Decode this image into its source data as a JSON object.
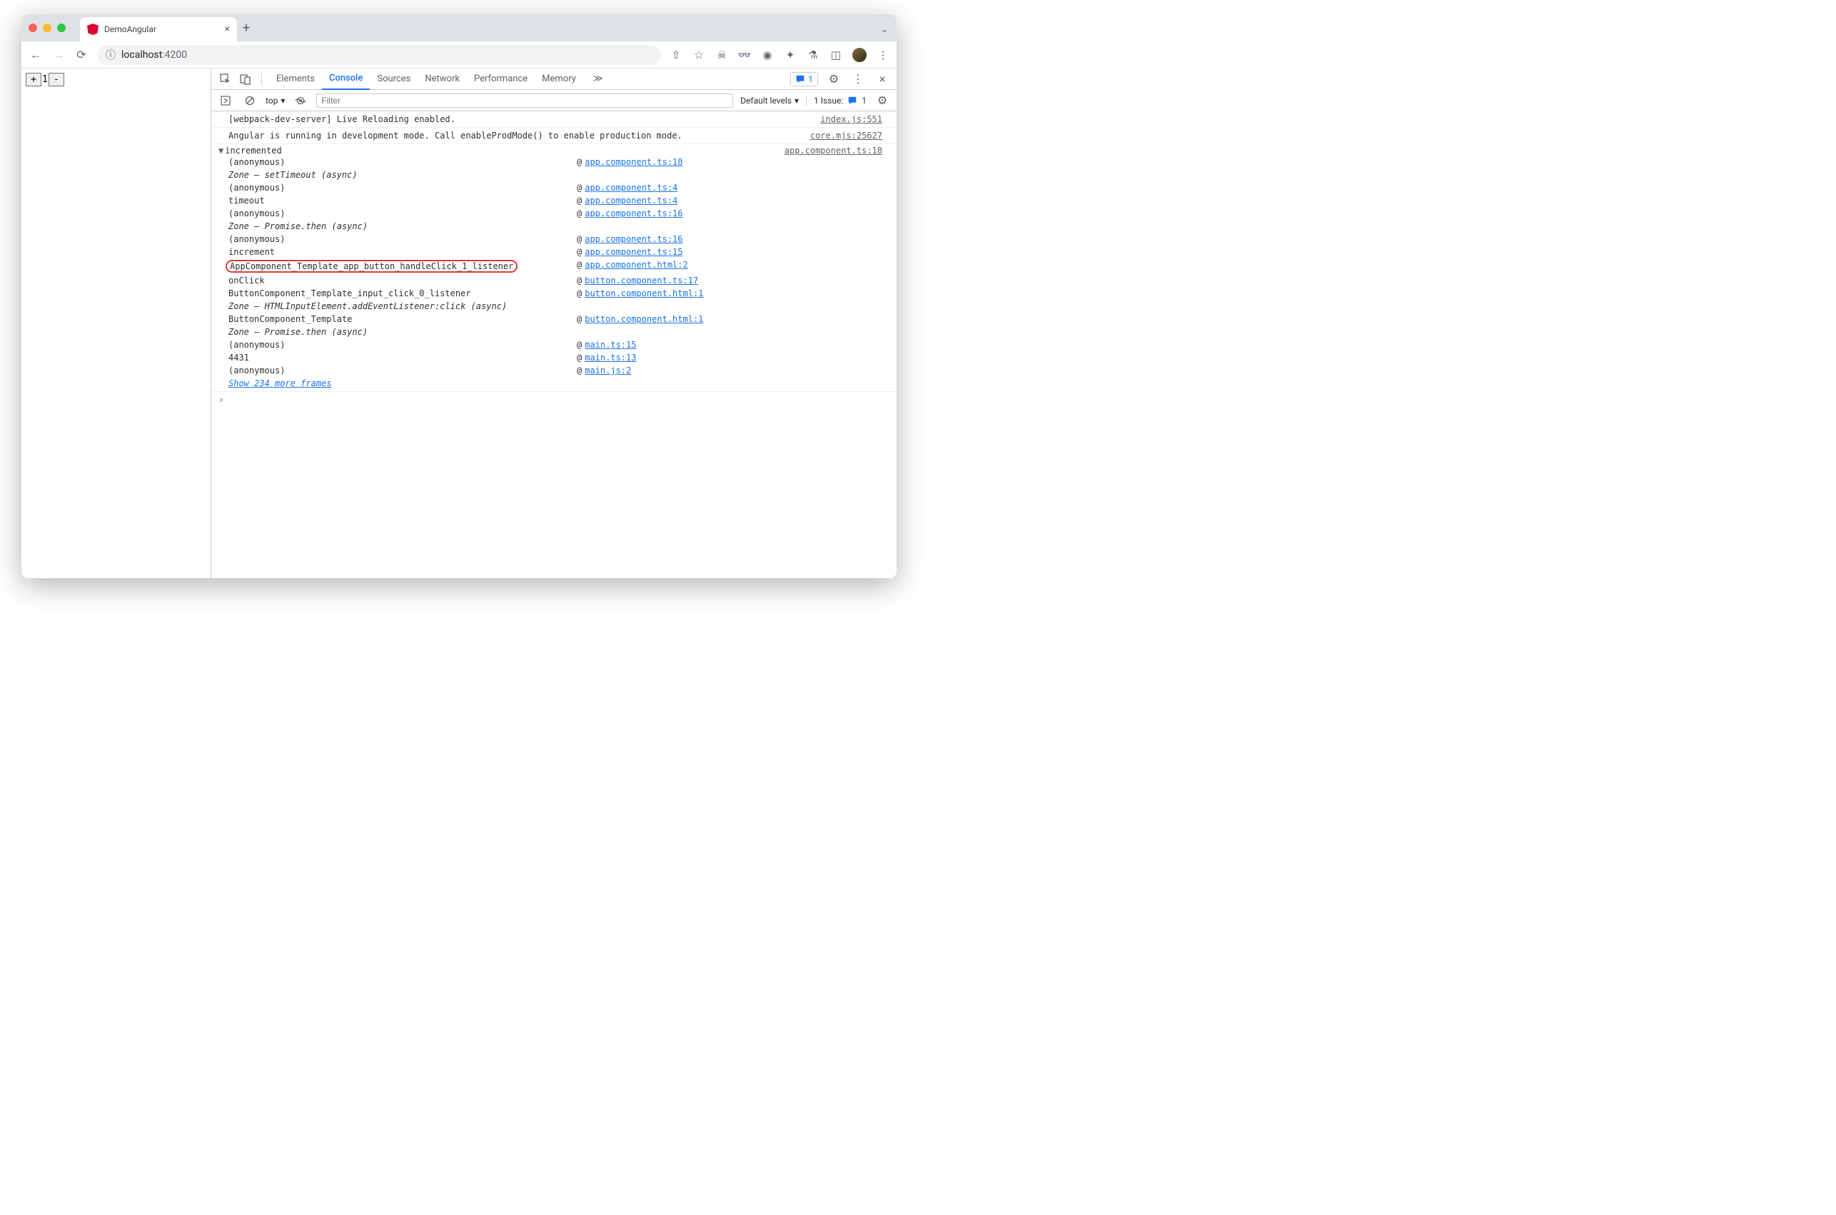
{
  "browser": {
    "tab_title": "DemoAngular",
    "url_host": "localhost",
    "url_port": ":4200"
  },
  "page": {
    "plus": "+",
    "count": "1",
    "minus": "-"
  },
  "devtools": {
    "tabs": [
      "Elements",
      "Console",
      "Sources",
      "Network",
      "Performance",
      "Memory"
    ],
    "active_tab": "Console",
    "overflow": "≫",
    "badge_count": "1",
    "toolbar": {
      "context": "top",
      "filter_placeholder": "Filter",
      "levels": "Default levels",
      "issue_label": "1 Issue:",
      "issue_count": "1"
    },
    "logs": [
      {
        "msg": "[webpack-dev-server] Live Reloading enabled.",
        "src": "index.js:551"
      },
      {
        "msg": "Angular is running in development mode. Call enableProdMode() to enable production mode.",
        "src": "core.mjs:25627"
      }
    ],
    "trace": {
      "label": "incremented",
      "src": "app.component.ts:18",
      "frames": [
        {
          "fn": "(anonymous)",
          "link": "app.component.ts:18"
        },
        {
          "zone": "Zone — setTimeout (async)"
        },
        {
          "fn": "(anonymous)",
          "link": "app.component.ts:4"
        },
        {
          "fn": "timeout",
          "link": "app.component.ts:4"
        },
        {
          "fn": "(anonymous)",
          "link": "app.component.ts:16"
        },
        {
          "zone": "Zone — Promise.then (async)"
        },
        {
          "fn": "(anonymous)",
          "link": "app.component.ts:16"
        },
        {
          "fn": "increment",
          "link": "app.component.ts:15"
        },
        {
          "fn": "AppComponent_Template_app_button_handleClick_1_listener",
          "link": "app.component.html:2",
          "highlight": true
        },
        {
          "fn": "onClick",
          "link": "button.component.ts:17"
        },
        {
          "fn": "ButtonComponent_Template_input_click_0_listener",
          "link": "button.component.html:1"
        },
        {
          "zone": "Zone — HTMLInputElement.addEventListener:click (async)"
        },
        {
          "fn": "ButtonComponent_Template",
          "link": "button.component.html:1"
        },
        {
          "zone": "Zone — Promise.then (async)"
        },
        {
          "fn": "(anonymous)",
          "link": "main.ts:15"
        },
        {
          "fn": "4431",
          "link": "main.ts:13"
        },
        {
          "fn": "(anonymous)",
          "link": "main.js:2"
        }
      ],
      "show_more": "Show 234 more frames"
    },
    "prompt": "›"
  }
}
